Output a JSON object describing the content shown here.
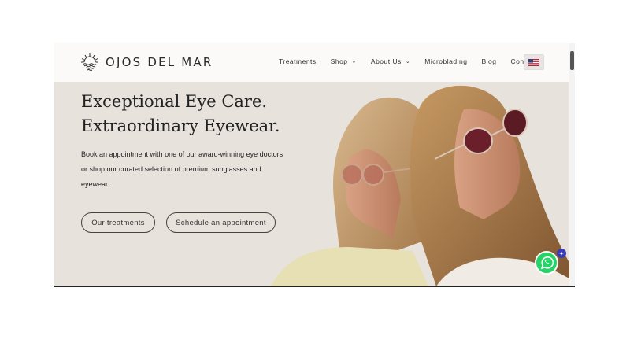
{
  "brand": {
    "name": "OJOS DEL MAR"
  },
  "nav": {
    "items": [
      {
        "label": "Treatments",
        "dropdown": false
      },
      {
        "label": "Shop",
        "dropdown": true
      },
      {
        "label": "About Us",
        "dropdown": true
      },
      {
        "label": "Microblading",
        "dropdown": false
      },
      {
        "label": "Blog",
        "dropdown": false
      },
      {
        "label": "Contact",
        "dropdown": false
      }
    ]
  },
  "hero": {
    "title_line1": "Exceptional Eye Care.",
    "title_line2": "Extraordinary Eyewear.",
    "description": "Book an appointment with one of our award-winning eye doctors or shop our curated selection of premium sunglasses and eyewear.",
    "button_primary": "Our treatments",
    "button_secondary": "Schedule an appointment"
  },
  "icons": {
    "logo": "sun-waves-icon",
    "flag": "us-flag-icon",
    "whatsapp": "whatsapp-icon",
    "chevron": "chevron-down-icon"
  },
  "colors": {
    "hero_bg": "#e7e2dc",
    "whatsapp": "#25d366",
    "text": "#222222"
  }
}
